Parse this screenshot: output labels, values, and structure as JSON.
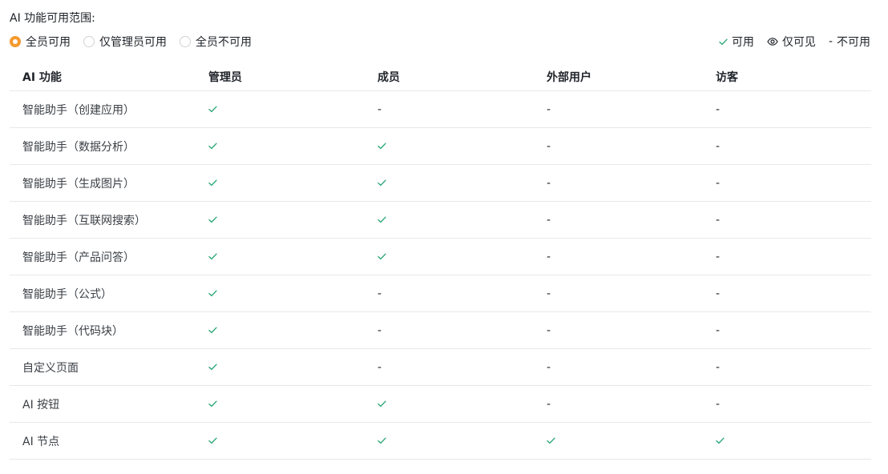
{
  "section": {
    "title": "AI 功能可用范围:"
  },
  "scope_options": [
    {
      "label": "全员可用",
      "selected": true
    },
    {
      "label": "仅管理员可用",
      "selected": false
    },
    {
      "label": "全员不可用",
      "selected": false
    }
  ],
  "legend": {
    "available": "可用",
    "view_only": "仅可见",
    "unavailable_symbol": "-",
    "unavailable": "不可用"
  },
  "colors": {
    "accent": "#f49a2f",
    "check": "#2ea879",
    "border": "#e6e8eb"
  },
  "table": {
    "headers": [
      "AI 功能",
      "管理员",
      "成员",
      "外部用户",
      "访客"
    ],
    "rows": [
      {
        "feature": "智能助手（创建应用）",
        "values": [
          "check",
          "-",
          "-",
          "-"
        ]
      },
      {
        "feature": "智能助手（数据分析）",
        "values": [
          "check",
          "check",
          "-",
          "-"
        ]
      },
      {
        "feature": "智能助手（生成图片）",
        "values": [
          "check",
          "check",
          "-",
          "-"
        ]
      },
      {
        "feature": "智能助手（互联网搜索）",
        "values": [
          "check",
          "check",
          "-",
          "-"
        ]
      },
      {
        "feature": "智能助手（产品问答）",
        "values": [
          "check",
          "check",
          "-",
          "-"
        ]
      },
      {
        "feature": "智能助手（公式）",
        "values": [
          "check",
          "-",
          "-",
          "-"
        ]
      },
      {
        "feature": "智能助手（代码块）",
        "values": [
          "check",
          "-",
          "-",
          "-"
        ]
      },
      {
        "feature": "自定义页面",
        "values": [
          "check",
          "-",
          "-",
          "-"
        ]
      },
      {
        "feature": "AI 按钮",
        "values": [
          "check",
          "check",
          "-",
          "-"
        ]
      },
      {
        "feature": "AI 节点",
        "values": [
          "check",
          "check",
          "check",
          "check"
        ]
      }
    ]
  }
}
